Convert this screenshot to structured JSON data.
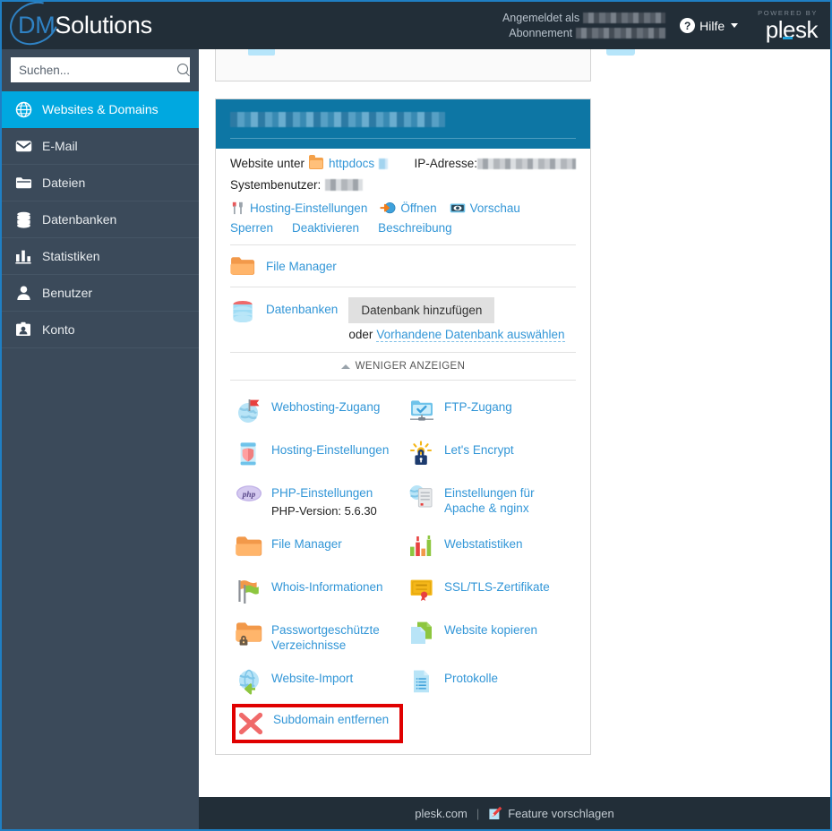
{
  "brand": {
    "dm": "DM",
    "solutions": "Solutions"
  },
  "topbar": {
    "logged_in_label": "Angemeldet als",
    "subscription_label": "Abonnement",
    "help_label": "Hilfe",
    "help_icon": "question-mark-circle-icon",
    "powered_by": "POWERED BY",
    "plesk": "plesk"
  },
  "search": {
    "placeholder": "Suchen...",
    "value": "",
    "icon": "search-icon"
  },
  "sidebar": {
    "items": [
      {
        "label": "Websites & Domains",
        "icon": "globe-icon",
        "active": true
      },
      {
        "label": "E-Mail",
        "icon": "envelope-icon",
        "active": false
      },
      {
        "label": "Dateien",
        "icon": "folder-icon",
        "active": false
      },
      {
        "label": "Datenbanken",
        "icon": "database-icon",
        "active": false
      },
      {
        "label": "Statistiken",
        "icon": "bar-chart-icon",
        "active": false
      },
      {
        "label": "Benutzer",
        "icon": "user-icon",
        "active": false
      },
      {
        "label": "Konto",
        "icon": "account-card-icon",
        "active": false
      }
    ]
  },
  "card": {
    "title_redacted": true,
    "website_label": "Website unter",
    "httpdocs": "httpdocs",
    "ip_label": "IP-Adresse:",
    "sysuser_label": "Systembenutzer:",
    "actions": [
      {
        "label": "Hosting-Einstellungen",
        "icon": "tools-icon"
      },
      {
        "label": "Öffnen",
        "icon": "open-arrow-globe-icon"
      },
      {
        "label": "Vorschau",
        "icon": "preview-eye-icon"
      }
    ],
    "actions2": [
      {
        "label": "Sperren"
      },
      {
        "label": "Deaktivieren"
      },
      {
        "label": "Beschreibung"
      }
    ],
    "file_manager_row": {
      "label": "File Manager",
      "icon": "folder-orange-icon"
    },
    "databases_row": {
      "label": "Datenbanken",
      "icon": "database-red-icon",
      "add_button": "Datenbank hinzufügen",
      "oder": "oder",
      "existing_link": "Vorhandene Datenbank auswählen"
    },
    "less_label": "WENIGER ANZEIGEN",
    "less_icon": "chevron-up-icon"
  },
  "grid": [
    {
      "label": "Webhosting-Zugang",
      "icon": "globe-flag-icon",
      "note": null,
      "highlight": false
    },
    {
      "label": "FTP-Zugang",
      "icon": "ftp-folder-check-icon",
      "note": null,
      "highlight": false
    },
    {
      "label": "Hosting-Einstellungen",
      "icon": "shield-settings-icon",
      "note": null,
      "highlight": false
    },
    {
      "label": "Let's Encrypt",
      "icon": "padlock-sun-icon",
      "note": null,
      "highlight": false
    },
    {
      "label": "PHP-Einstellungen",
      "icon": "php-icon",
      "note": "PHP-Version: 5.6.30",
      "highlight": false
    },
    {
      "label": "Einstellungen für Apache & nginx",
      "icon": "server-globe-icon",
      "note": null,
      "highlight": false
    },
    {
      "label": "File Manager",
      "icon": "folder-orange-icon",
      "note": null,
      "highlight": false
    },
    {
      "label": "Webstatistiken",
      "icon": "bar-chart-color-icon",
      "note": null,
      "highlight": false
    },
    {
      "label": "Whois-Informationen",
      "icon": "flags-icon",
      "note": null,
      "highlight": false
    },
    {
      "label": "SSL/TLS-Zertifikate",
      "icon": "certificate-icon",
      "note": null,
      "highlight": false
    },
    {
      "label": "Passwortgeschützte Verzeichnisse",
      "icon": "folder-lock-icon",
      "note": null,
      "highlight": false
    },
    {
      "label": "Website kopieren",
      "icon": "copy-pages-icon",
      "note": null,
      "highlight": false
    },
    {
      "label": "Website-Import",
      "icon": "globe-import-arrow-icon",
      "note": null,
      "highlight": false
    },
    {
      "label": "Protokolle",
      "icon": "document-lines-icon",
      "note": null,
      "highlight": false
    },
    {
      "label": "Subdomain entfernen",
      "icon": "red-x-icon",
      "note": null,
      "highlight": true
    }
  ],
  "footer": {
    "site": "plesk.com",
    "separator": "|",
    "feature_label": "Feature vorschlagen",
    "feature_icon": "pencil-note-icon"
  },
  "colors": {
    "topbar": "#222e38",
    "sidebar": "#3b4a5a",
    "sidebar_active": "#00a8e0",
    "card_header": "#0d76a4",
    "link": "#3296d7",
    "highlight": "#e00000",
    "brand_blue": "#2f82c4"
  }
}
